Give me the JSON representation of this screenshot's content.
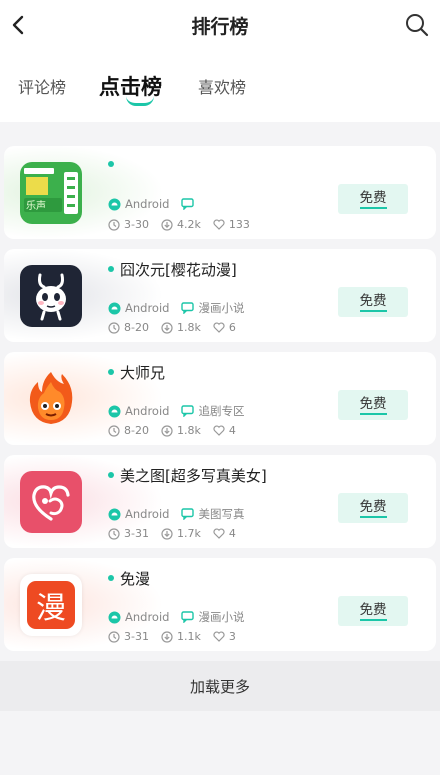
{
  "header": {
    "title": "排行榜"
  },
  "tabs": [
    {
      "label": "评论榜",
      "active": false
    },
    {
      "label": "点击榜",
      "active": true
    },
    {
      "label": "喜欢榜",
      "active": false
    }
  ],
  "colors": {
    "accent": "#1cc6a8",
    "free_bg": "#e3f7f1"
  },
  "apps": [
    {
      "name": "",
      "platform": "Android",
      "category": "",
      "date": "3-30",
      "downloads": "4.2k",
      "likes": "133",
      "action": "免费",
      "icon": "green-board-icon"
    },
    {
      "name": "囧次元[樱花动漫]",
      "platform": "Android",
      "category": "漫画小说",
      "date": "8-20",
      "downloads": "1.8k",
      "likes": "6",
      "action": "免费",
      "icon": "cartoon-rabbit-icon"
    },
    {
      "name": "大师兄",
      "platform": "Android",
      "category": "追剧专区",
      "date": "8-20",
      "downloads": "1.8k",
      "likes": "4",
      "action": "免费",
      "icon": "flame-monkey-icon"
    },
    {
      "name": "美之图[超多写真美女]",
      "platform": "Android",
      "category": "美图写真",
      "date": "3-31",
      "downloads": "1.7k",
      "likes": "4",
      "action": "免费",
      "icon": "heart-logo-icon"
    },
    {
      "name": "免漫",
      "platform": "Android",
      "category": "漫画小说",
      "date": "3-31",
      "downloads": "1.1k",
      "likes": "3",
      "action": "免费",
      "icon": "man-character-icon"
    }
  ],
  "load_more": "加载更多"
}
